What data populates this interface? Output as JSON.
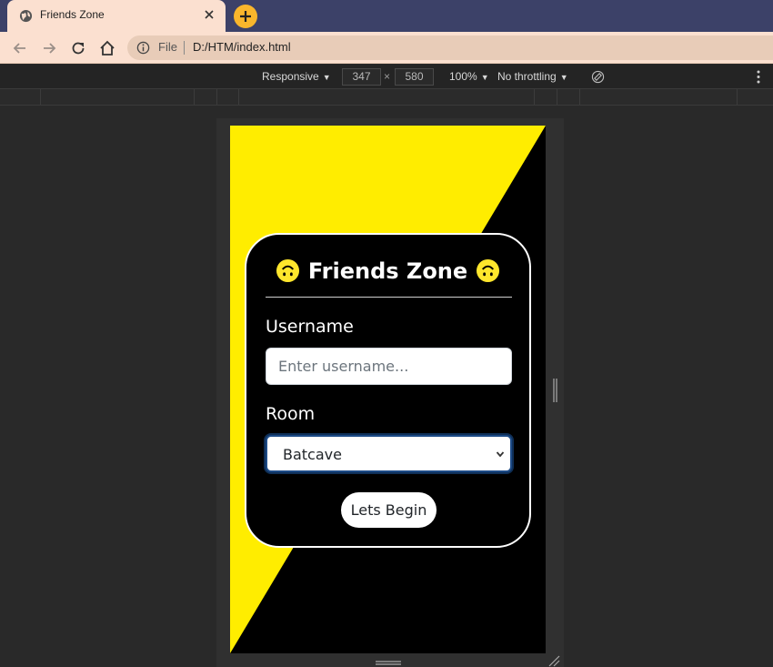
{
  "browser": {
    "tab_title": "Friends Zone",
    "url_scheme": "File",
    "url": "D:/HTM/index.html",
    "icons": [
      "globe-icon",
      "close-icon",
      "plus-icon",
      "back-arrow-icon",
      "forward-arrow-icon",
      "reload-icon",
      "home-icon",
      "info-icon"
    ]
  },
  "devtools": {
    "device_mode": "Responsive",
    "width": "347",
    "height": "580",
    "dimension_separator": "×",
    "zoom": "100%",
    "throttling": "No throttling",
    "icons": [
      "caret-down-icon",
      "rotate-icon",
      "kebab-menu-icon"
    ]
  },
  "app": {
    "title": "Friends Zone",
    "title_emoji": "upside-down-face-emoji",
    "username_label": "Username",
    "username_placeholder": "Enter username...",
    "room_label": "Room",
    "room_selected": "Batcave",
    "submit_label": "Lets Begin",
    "colors": {
      "yellow": "#ffed00",
      "black": "#000000",
      "card_border": "#ffffff",
      "emoji": "#fee62c"
    }
  }
}
